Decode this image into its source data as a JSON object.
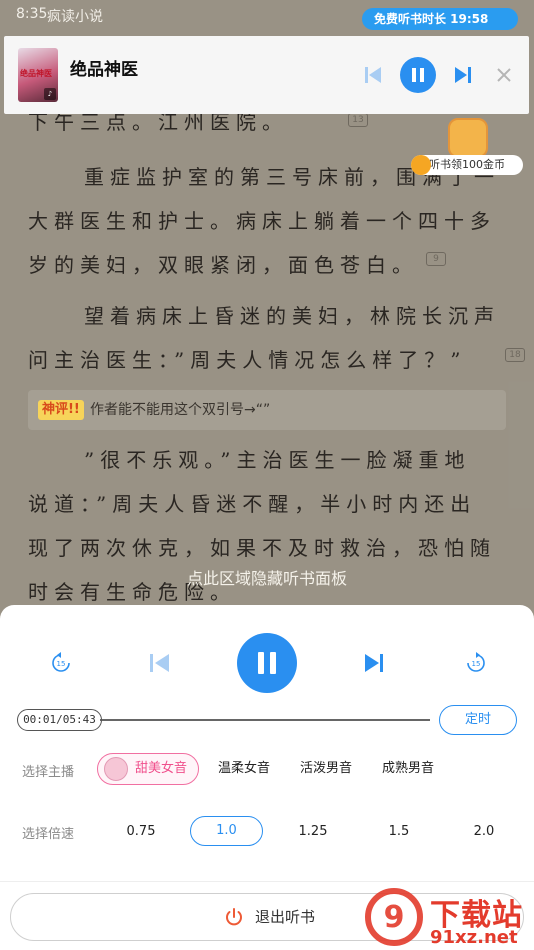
{
  "status_bar": {
    "time": "8:35",
    "app_name": "疯读小说",
    "free_badge": "免费听书时长 19:58"
  },
  "reader": {
    "paragraphs": [
      {
        "lines": [
          "下午三点。江州医院。"
        ],
        "comment_count": "13"
      },
      {
        "lines": [
          "重症监护室的第三号床前，围满了一",
          "大群医生和护士。病床上躺着一个四十多",
          "岁的美妇，双眼紧闭，面色苍白。"
        ],
        "comment_count": "9"
      },
      {
        "lines": [
          "望着病床上昏迷的美妇，林院长沉声",
          "问主治医生：”周夫人情况怎么样了？”"
        ],
        "comment_count": "18"
      },
      {
        "lines": [
          "”很不乐观。”主治医生一脸凝重地",
          "说道：”周夫人昏迷不醒，半小时内还出",
          "现了两次休克，如果不及时救治，恐怕随",
          "时会有生命危险。"
        ]
      }
    ],
    "hot_comment": {
      "tag": "神评!!",
      "text": "作者能不能用这个双引号→“”"
    },
    "coin_promo": "听书领100金币",
    "hide_hint": "点此区域隐藏听书面板"
  },
  "mini_player": {
    "book_title": "绝品神医",
    "cover_text": "绝品神医",
    "icons": [
      "skip-previous-icon",
      "pause-icon",
      "skip-next-icon",
      "close-icon"
    ]
  },
  "panel": {
    "progress": {
      "current": "00:01",
      "total": "05:43",
      "display": "00:01/05:43",
      "fraction": 0.003
    },
    "timer_label": "定时",
    "voice_label": "选择主播",
    "voices": [
      "甜美女音",
      "温柔女音",
      "活泼男音",
      "成熟男音"
    ],
    "selected_voice": "甜美女音",
    "speed_label": "选择倍速",
    "speeds": [
      "0.75",
      "1.0",
      "1.25",
      "1.5",
      "2.0"
    ],
    "selected_speed": "1.0",
    "exit_label": "退出听书"
  },
  "colors": {
    "accent": "#2a8ff0",
    "pink": "#f0508c",
    "badge": "#2a9cf0"
  },
  "watermark": {
    "text": "下载站",
    "site": "91xz.net"
  }
}
